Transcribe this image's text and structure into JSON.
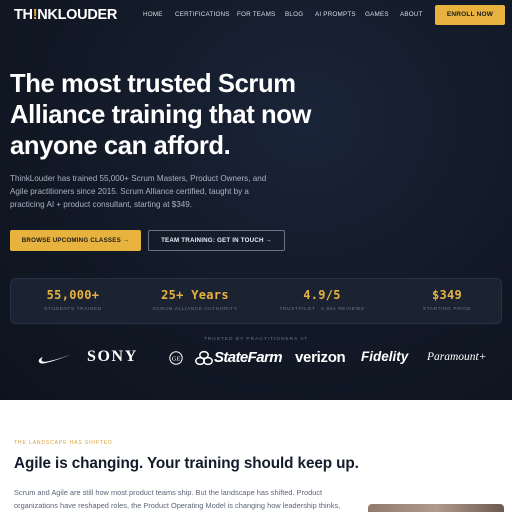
{
  "brand": {
    "logo_prefix": "TH",
    "logo_mark": "!",
    "logo_suffix": "NKLOUDER"
  },
  "nav": {
    "items": [
      "HOME",
      "CERTIFICATIONS",
      "FOR TEAMS",
      "BLOG",
      "AI PROMPTS",
      "GAMES",
      "ABOUT"
    ],
    "cta": "ENROLL NOW"
  },
  "hero": {
    "headline_lines": [
      "The most trusted Scrum",
      "Alliance training that now",
      "anyone can afford."
    ],
    "description_lines": [
      "ThinkLouder has trained 55,000+ Scrum Masters, Product Owners, and",
      "Agile practitioners since 2015. Scrum Alliance certified, taught by a",
      "practicing AI + product consultant, starting at $349."
    ],
    "primary_button": "BROWSE UPCOMING CLASSES →",
    "secondary_button": "TEAM TRAINING: GET IN TOUCH →"
  },
  "stats": [
    {
      "value": "55,000+",
      "label": "STUDENTS TRAINED"
    },
    {
      "value": "25+ Years",
      "label": "SCRUM ALLIANCE AUTHORITY"
    },
    {
      "value": "4.9/5",
      "label": "TRUSTPILOT · 5,564 REVIEWS"
    },
    {
      "value": "$349",
      "label": "STARTING PRICE"
    }
  ],
  "trusted_label": "TRUSTED BY PRACTITIONERS AT",
  "clients": {
    "nike": "nike-swoosh-logo",
    "sony": "SONY",
    "ge": "ge-monogram-logo",
    "statefarm": "StateFarm",
    "verizon": "verizon",
    "fidelity": "Fidelity",
    "paramount": "Paramount+"
  },
  "section": {
    "eyebrow": "THE LANDSCAPE HAS SHIFTED",
    "heading": "Agile is changing. Your training should keep up.",
    "body_lines": [
      "Scrum and Agile are still how most product teams ship. But the landscape has shifted. Product",
      "organizations have reshaped roles, the Product Operating Model is changing how leadership thinks,"
    ]
  },
  "colors": {
    "accent": "#e8b23e",
    "hero_bg": "#121926",
    "stats_bg": "#1b2333"
  }
}
